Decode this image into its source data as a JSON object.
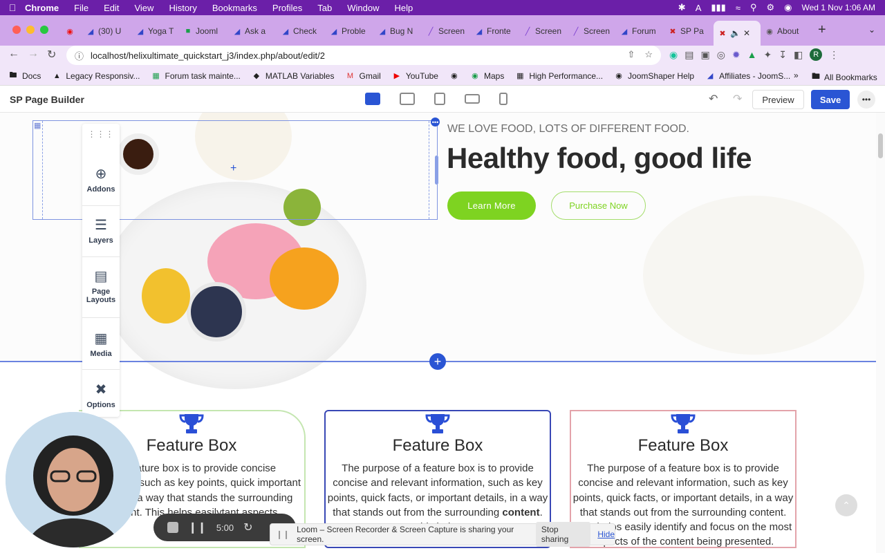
{
  "menubar": {
    "app": "Chrome",
    "items": [
      "File",
      "Edit",
      "View",
      "History",
      "Bookmarks",
      "Profiles",
      "Tab",
      "Window",
      "Help"
    ],
    "clock": "Wed 1 Nov 1:06 AM"
  },
  "tabs": [
    {
      "label": "(30) U",
      "icon": "youtube-icon"
    },
    {
      "label": "Yoga T",
      "icon": "joomshaper-icon"
    },
    {
      "label": "Jooml",
      "icon": "meet-icon"
    },
    {
      "label": "Ask a",
      "icon": "joomshaper-icon"
    },
    {
      "label": "Check",
      "icon": "joomshaper-icon"
    },
    {
      "label": "Proble",
      "icon": "joomshaper-icon"
    },
    {
      "label": "Bug N",
      "icon": "joomshaper-icon"
    },
    {
      "label": "Screen",
      "icon": "pencil-icon"
    },
    {
      "label": "Fronte",
      "icon": "joomshaper-icon"
    },
    {
      "label": "Screen",
      "icon": "pencil-icon"
    },
    {
      "label": "Screen",
      "icon": "pencil-icon"
    },
    {
      "label": "Forum",
      "icon": "joomshaper-icon"
    },
    {
      "label": "SP Pa",
      "icon": "joomla-icon"
    },
    {
      "label": "",
      "icon": "joomla-icon",
      "active": true
    },
    {
      "label": "About",
      "icon": "chrome-icon"
    }
  ],
  "address": {
    "url": "localhost/helixultimate_quickstart_j3/index.php/about/edit/2"
  },
  "bookmarks": [
    {
      "label": "Docs",
      "icon": "folder-icon"
    },
    {
      "label": "Legacy Responsiv...",
      "icon": "joomla-icon"
    },
    {
      "label": "Forum task mainte...",
      "icon": "sheets-icon"
    },
    {
      "label": "MATLAB Variables",
      "icon": "diamond-icon"
    },
    {
      "label": "Gmail",
      "icon": "gmail-icon"
    },
    {
      "label": "YouTube",
      "icon": "youtube-icon"
    },
    {
      "label": "",
      "icon": "globe-icon"
    },
    {
      "label": "Maps",
      "icon": "maps-icon"
    },
    {
      "label": "High Performance...",
      "icon": "bookmark-icon"
    },
    {
      "label": "JoomShaper Help",
      "icon": "joomshaper-icon"
    },
    {
      "label": "Affiliates - JoomS...",
      "icon": "joomshaper-icon"
    }
  ],
  "bookmarks_more": "»",
  "all_bookmarks": "All Bookmarks",
  "builder": {
    "title": "SP Page Builder",
    "preview_label": "Preview",
    "save_label": "Save"
  },
  "sidebar": [
    {
      "label": "Addons",
      "icon": "plus-circle-icon"
    },
    {
      "label": "Layers",
      "icon": "layers-icon"
    },
    {
      "label": "Page Layouts",
      "icon": "layout-icon"
    },
    {
      "label": "Media",
      "icon": "image-icon"
    },
    {
      "label": "Options",
      "icon": "wrench-icon"
    }
  ],
  "hero": {
    "tagline": "WE LOVE FOOD, LOTS OF DIFFERENT FOOD.",
    "headline": "Healthy food, good life",
    "primary_btn": "Learn More",
    "secondary_btn": "Purchase Now"
  },
  "features": [
    {
      "title": "Feature Box",
      "text_before": "of a feature box is to provide concise information, such as key points, quick important details, in a way that stands the surrounding content. This helps easily",
      "bold": "",
      "text_after": "tant aspects",
      "border": "#a8d98a"
    },
    {
      "title": "Feature Box",
      "text_before": "The purpose of a feature box is to provide concise and relevant information, such as key points, quick facts, or important details, in a way that stands out from the surrounding ",
      "bold": "content",
      "text_after": ". This helps",
      "border": "#3847b5"
    },
    {
      "title": "Feature Box",
      "text_before": "The purpose of a feature box is to provide concise and relevant information, such as key points, quick facts, or important details, in a way that stands out from the surrounding content. This helps easily identify and focus on the most aspects of the content being presented.",
      "bold": "",
      "text_after": "",
      "border": "#e3a3aa"
    }
  ],
  "colors": {
    "accent": "#2a55d4",
    "green": "#7ed321",
    "trophy": "#2a4fd6"
  },
  "loom": {
    "timer": "5:00",
    "share_text": "Loom – Screen Recorder & Screen Capture is sharing your screen.",
    "stop_label": "Stop sharing",
    "hide_label": "Hide"
  }
}
